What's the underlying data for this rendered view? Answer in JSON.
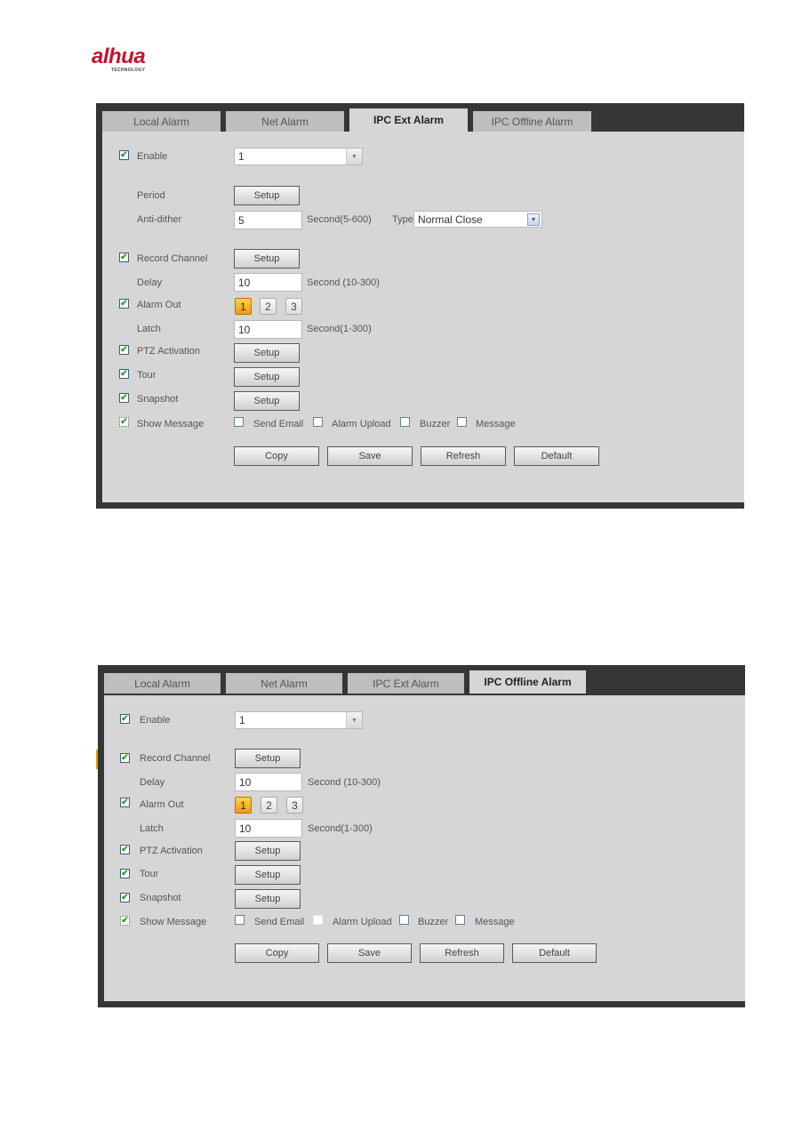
{
  "logo": {
    "brand": "alhua",
    "tagline": "TECHNOLOGY"
  },
  "panels": [
    {
      "tabs": [
        {
          "label": "Local Alarm",
          "active": false
        },
        {
          "label": "Net Alarm",
          "active": false
        },
        {
          "label": "IPC Ext Alarm",
          "active": true
        },
        {
          "label": "IPC Offline Alarm",
          "active": false
        }
      ],
      "enable": {
        "label": "Enable",
        "checked": true,
        "value": "1"
      },
      "period": {
        "label": "Period",
        "button": "Setup"
      },
      "anti_dither": {
        "label": "Anti-dither",
        "value": "5",
        "unit": "Second(5-600)",
        "type_label": "Type",
        "type_value": "Normal Close"
      },
      "record_channel": {
        "label": "Record Channel",
        "checked": true,
        "button": "Setup"
      },
      "delay": {
        "label": "Delay",
        "value": "10",
        "unit": "Second (10-300)"
      },
      "alarm_out": {
        "label": "Alarm Out",
        "checked": true,
        "options": [
          "1",
          "2",
          "3"
        ],
        "selected": "1"
      },
      "latch": {
        "label": "Latch",
        "value": "10",
        "unit": "Second(1-300)"
      },
      "ptz": {
        "label": "PTZ Activation",
        "checked": true,
        "button": "Setup"
      },
      "tour": {
        "label": "Tour",
        "checked": true,
        "button": "Setup"
      },
      "snapshot": {
        "label": "Snapshot",
        "checked": true,
        "button": "Setup"
      },
      "show_message": {
        "label": "Show Message",
        "checked": true
      },
      "send_email": {
        "label": "Send Email",
        "checked": false
      },
      "alarm_upload": {
        "label": "Alarm Upload",
        "checked": false
      },
      "buzzer": {
        "label": "Buzzer",
        "checked": false
      },
      "message": {
        "label": "Message",
        "checked": false
      },
      "actions": {
        "copy": "Copy",
        "save": "Save",
        "refresh": "Refresh",
        "default": "Default"
      }
    },
    {
      "tabs": [
        {
          "label": "Local Alarm",
          "active": false
        },
        {
          "label": "Net Alarm",
          "active": false
        },
        {
          "label": "IPC Ext Alarm",
          "active": false
        },
        {
          "label": "IPC Offline Alarm",
          "active": true
        }
      ],
      "enable": {
        "label": "Enable",
        "checked": true,
        "value": "1"
      },
      "record_channel": {
        "label": "Record Channel",
        "checked": true,
        "button": "Setup"
      },
      "delay": {
        "label": "Delay",
        "value": "10",
        "unit": "Second (10-300)"
      },
      "alarm_out": {
        "label": "Alarm Out",
        "checked": true,
        "options": [
          "1",
          "2",
          "3"
        ],
        "selected": "1"
      },
      "latch": {
        "label": "Latch",
        "value": "10",
        "unit": "Second(1-300)"
      },
      "ptz": {
        "label": "PTZ Activation",
        "checked": true,
        "button": "Setup"
      },
      "tour": {
        "label": "Tour",
        "checked": true,
        "button": "Setup"
      },
      "snapshot": {
        "label": "Snapshot",
        "checked": true,
        "button": "Setup"
      },
      "show_message": {
        "label": "Show Message",
        "checked": true
      },
      "send_email": {
        "label": "Send Email",
        "checked": false
      },
      "alarm_upload": {
        "label": "Alarm Upload",
        "checked": false
      },
      "buzzer": {
        "label": "Buzzer",
        "checked": false
      },
      "message": {
        "label": "Message",
        "checked": false
      },
      "actions": {
        "copy": "Copy",
        "save": "Save",
        "refresh": "Refresh",
        "default": "Default"
      }
    }
  ],
  "icons": {
    "check": "✔",
    "dropdown": "▼"
  }
}
